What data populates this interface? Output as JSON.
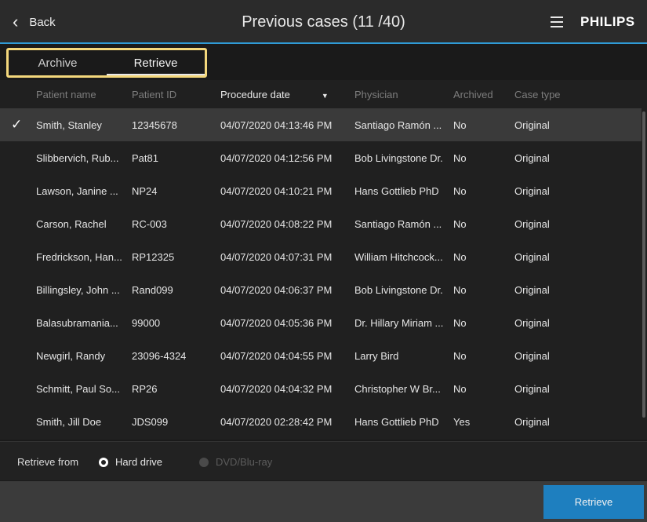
{
  "header": {
    "back_label": "Back",
    "title": "Previous cases (11 /40)",
    "brand": "PHILIPS",
    "menu_icon": "hamburger-menu-icon",
    "back_icon": "chevron-left-icon"
  },
  "tabs": [
    {
      "label": "Archive",
      "active": false
    },
    {
      "label": "Retrieve",
      "active": true
    }
  ],
  "table": {
    "columns": {
      "name": "Patient name",
      "id": "Patient ID",
      "date": "Procedure date",
      "physician": "Physician",
      "archived": "Archived",
      "type": "Case type"
    },
    "sorted_by": "Procedure date",
    "sort_icon": "sort-descending-icon",
    "rows": [
      {
        "selected": true,
        "name": "Smith, Stanley",
        "id": "12345678",
        "date": "04/07/2020 04:13:46 PM",
        "physician": "Santiago Ramón ...",
        "archived": "No",
        "type": "Original"
      },
      {
        "selected": false,
        "name": "Slibbervich, Rub...",
        "id": "Pat81",
        "date": "04/07/2020 04:12:56 PM",
        "physician": "Bob Livingstone Dr.",
        "archived": "No",
        "type": "Original"
      },
      {
        "selected": false,
        "name": "Lawson, Janine ...",
        "id": "NP24",
        "date": "04/07/2020 04:10:21 PM",
        "physician": "Hans Gottlieb PhD",
        "archived": "No",
        "type": "Original"
      },
      {
        "selected": false,
        "name": "Carson, Rachel",
        "id": "RC-003",
        "date": "04/07/2020 04:08:22 PM",
        "physician": "Santiago Ramón ...",
        "archived": "No",
        "type": "Original"
      },
      {
        "selected": false,
        "name": "Fredrickson, Han...",
        "id": "RP12325",
        "date": "04/07/2020 04:07:31 PM",
        "physician": "William Hitchcock...",
        "archived": "No",
        "type": "Original"
      },
      {
        "selected": false,
        "name": "Billingsley, John ...",
        "id": "Rand099",
        "date": "04/07/2020 04:06:37 PM",
        "physician": "Bob Livingstone Dr.",
        "archived": "No",
        "type": "Original"
      },
      {
        "selected": false,
        "name": "Balasubramania...",
        "id": "99000",
        "date": "04/07/2020 04:05:36 PM",
        "physician": "Dr. Hillary Miriam ...",
        "archived": "No",
        "type": "Original"
      },
      {
        "selected": false,
        "name": "Newgirl, Randy",
        "id": "23096-4324",
        "date": "04/07/2020 04:04:55 PM",
        "physician": "Larry Bird",
        "archived": "No",
        "type": "Original"
      },
      {
        "selected": false,
        "name": "Schmitt, Paul So...",
        "id": "RP26",
        "date": "04/07/2020 04:04:32 PM",
        "physician": "Christopher W Br...",
        "archived": "No",
        "type": "Original"
      },
      {
        "selected": false,
        "name": "Smith, Jill Doe",
        "id": "JDS099",
        "date": "04/07/2020 02:28:42 PM",
        "physician": "Hans Gottlieb PhD",
        "archived": "Yes",
        "type": "Original"
      }
    ]
  },
  "retrieve_from": {
    "label": "Retrieve from",
    "options": [
      {
        "label": "Hard drive",
        "selected": true,
        "enabled": true
      },
      {
        "label": "DVD/Blu-ray",
        "selected": false,
        "enabled": false
      }
    ]
  },
  "actions": {
    "retrieve_label": "Retrieve",
    "retrieve_color": "#1e7fbf"
  },
  "colors": {
    "accent": "#2f9bd6",
    "tab_highlight": "#f3d77c"
  }
}
